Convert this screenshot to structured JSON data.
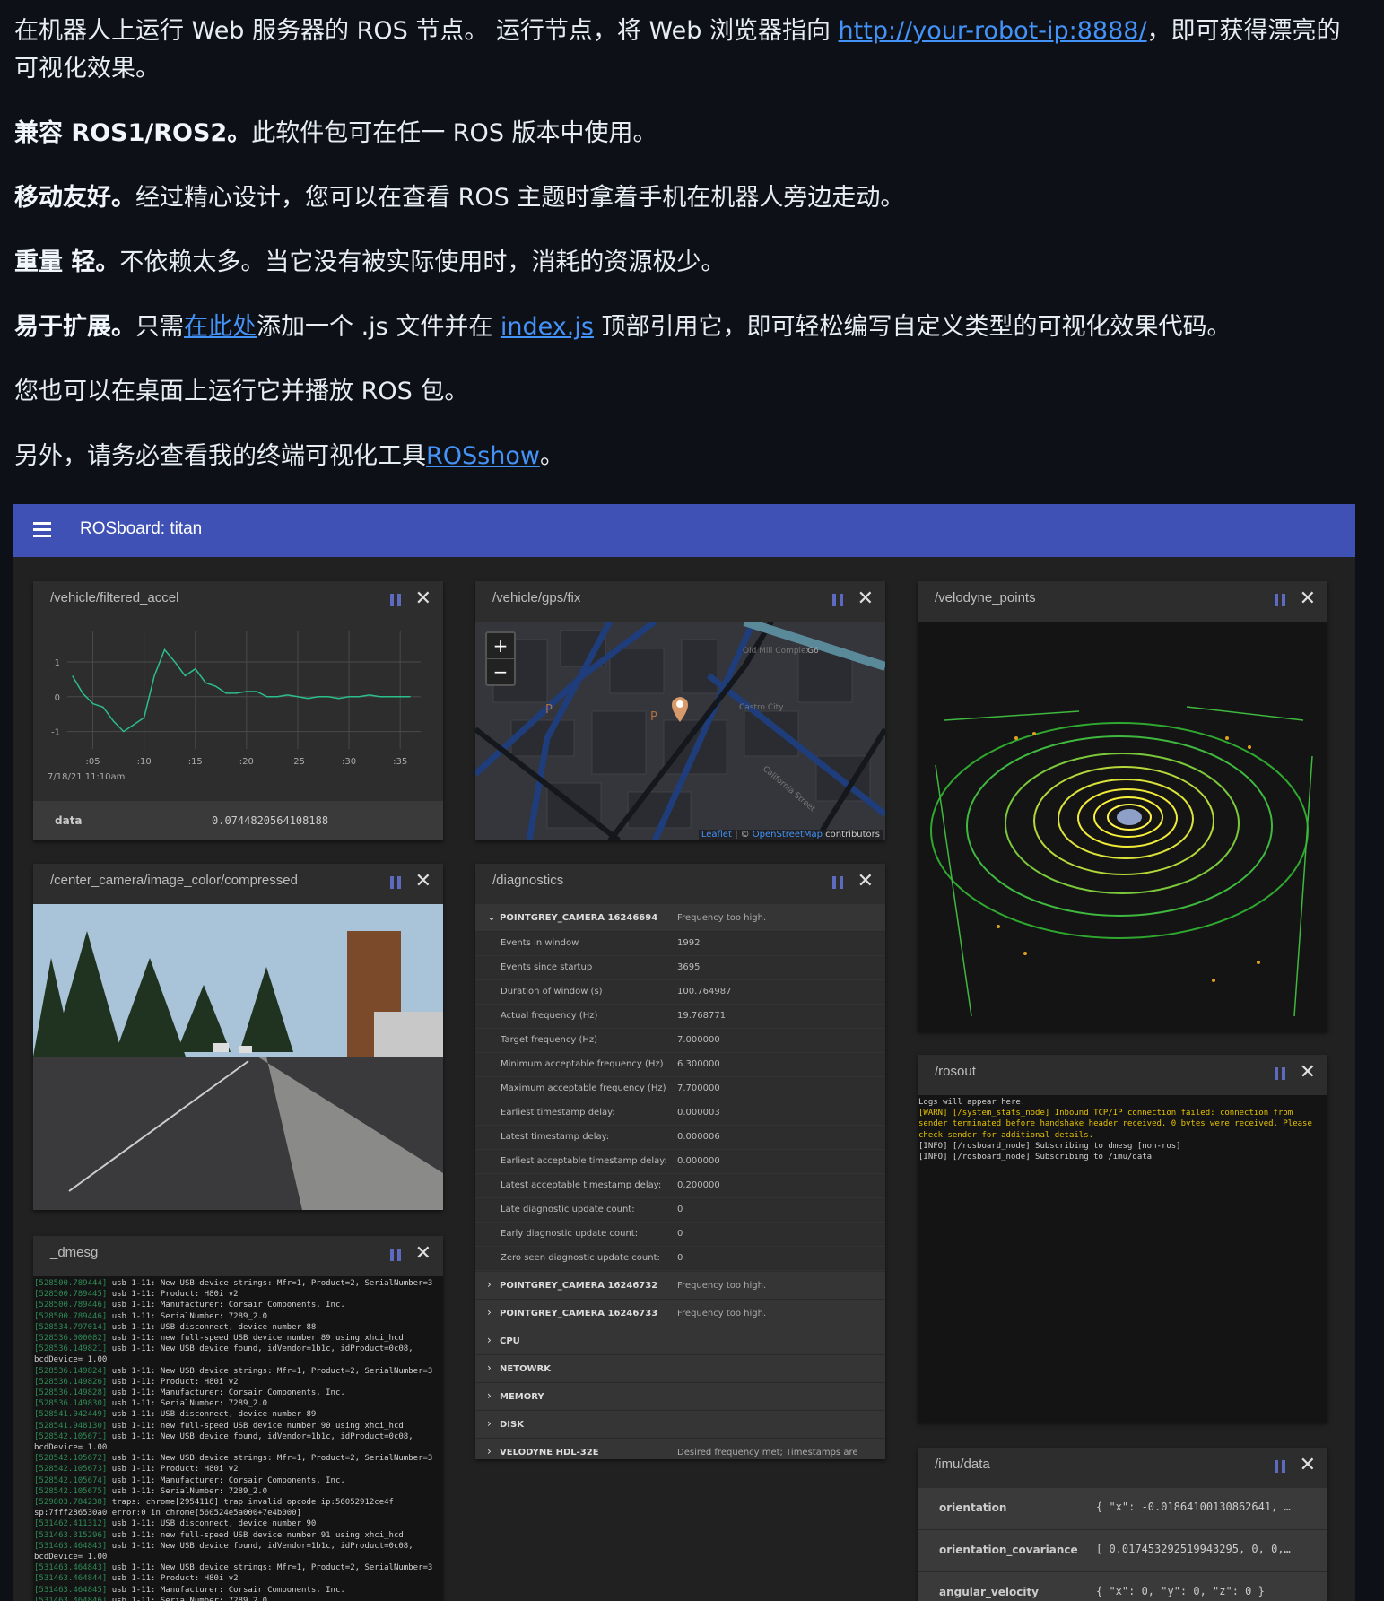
{
  "readme": {
    "p0_text_a": "在机器人上运行 Web 服务器的 ROS 节点。 运行节点，将 Web 浏览器指向 ",
    "p0_link": "http://your-robot-ip:8888/",
    "p0_text_b": "，即可获得漂亮的可视化效果。",
    "p1_bold": "兼容 ROS1/ROS2。",
    "p1_text": "此软件包可在任一 ROS 版本中使用。",
    "p2_bold": "移动友好。",
    "p2_text": "经过精心设计，您可以在查看 ROS 主题时拿着手机在机器人旁边走动。",
    "p3_bold": "重量 轻。",
    "p3_text": "不依赖太多。当它没有被实际使用时，消耗的资源极少。",
    "p4_bold": "易于扩展。",
    "p4_text_a": "只需",
    "p4_link_a": "在此处",
    "p4_text_b": "添加一个 .js 文件并在 ",
    "p4_link_b": "index.js",
    "p4_text_c": " 顶部引用它，即可轻松编写自定义类型的可视化效果代码。",
    "p5_text": "您也可以在桌面上运行它并播放 ROS 包。",
    "p6_text_a": "另外，请务必查看我的终端可视化工具",
    "p6_link": "ROSshow",
    "p6_text_b": "。"
  },
  "appbar": {
    "title": "ROSboard: titan"
  },
  "accent": "#3f51b5",
  "cards": {
    "accel": {
      "title": "/vehicle/filtered_accel",
      "data_key": "data",
      "data_value": "0.0744820564108188",
      "date_label": "7/18/21 11:10am"
    },
    "gps": {
      "title": "/vehicle/gps/fix",
      "zoom_in": "+",
      "zoom_out": "−",
      "attrib_a": "Leaflet",
      "attrib_b": " | © ",
      "attrib_c": "OpenStreetMap",
      "attrib_d": " contributors",
      "map_labels": [
        "Castro City",
        "California Street",
        "Old Mill Complex",
        "G6",
        "P",
        "P"
      ]
    },
    "velodyne": {
      "title": "/velodyne_points"
    },
    "camera": {
      "title": "/center_camera/image_color/compressed"
    },
    "diagnostics": {
      "title": "/diagnostics",
      "open_group": {
        "name": "POINTGREY_CAMERA 16246694",
        "status": "Frequency too high."
      },
      "rows": [
        {
          "k": "Events in window",
          "v": "1992"
        },
        {
          "k": "Events since startup",
          "v": "3695"
        },
        {
          "k": "Duration of window (s)",
          "v": "100.764987"
        },
        {
          "k": "Actual frequency (Hz)",
          "v": "19.768771"
        },
        {
          "k": "Target frequency (Hz)",
          "v": "7.000000"
        },
        {
          "k": "Minimum acceptable frequency (Hz)",
          "v": "6.300000"
        },
        {
          "k": "Maximum acceptable frequency (Hz)",
          "v": "7.700000"
        },
        {
          "k": "Earliest timestamp delay:",
          "v": "0.000003"
        },
        {
          "k": "Latest timestamp delay:",
          "v": "0.000006"
        },
        {
          "k": "Earliest acceptable timestamp delay:",
          "v": "0.000000"
        },
        {
          "k": "Latest acceptable timestamp delay:",
          "v": "0.200000"
        },
        {
          "k": "Late diagnostic update count:",
          "v": "0"
        },
        {
          "k": "Early diagnostic update count:",
          "v": "0"
        },
        {
          "k": "Zero seen diagnostic update count:",
          "v": "0"
        }
      ],
      "groups": [
        {
          "name": "POINTGREY_CAMERA 16246732",
          "status": "Frequency too high."
        },
        {
          "name": "POINTGREY_CAMERA 16246733",
          "status": "Frequency too high."
        },
        {
          "name": "CPU",
          "status": ""
        },
        {
          "name": "NETOWRK",
          "status": ""
        },
        {
          "name": "MEMORY",
          "status": ""
        },
        {
          "name": "DISK",
          "status": ""
        },
        {
          "name": "VELODYNE HDL-32E",
          "status": "Desired frequency met; Timestamps are reas..."
        }
      ]
    },
    "rosout": {
      "title": "/rosout",
      "lines": [
        {
          "cls": "",
          "text": "Logs will appear here."
        },
        {
          "cls": "warn",
          "text": "[WARN] [/system_stats_node] Inbound TCP/IP connection failed: connection from"
        },
        {
          "cls": "warn",
          "text": "sender terminated before handshake header received. 0 bytes were received. Please"
        },
        {
          "cls": "warn",
          "text": "check sender for additional details."
        },
        {
          "cls": "",
          "text": "[INFO] [/rosboard_node] Subscribing to dmesg [non-ros]"
        },
        {
          "cls": "",
          "text": "[INFO] [/rosboard_node] Subscribing to /imu/data"
        }
      ]
    },
    "dmesg": {
      "title": "_dmesg",
      "lines": [
        {
          "ts": "[528500.789444]",
          "text": " usb 1-11: New USB device strings: Mfr=1, Product=2, SerialNumber=3"
        },
        {
          "ts": "[528500.789445]",
          "text": " usb 1-11: Product: H80i v2"
        },
        {
          "ts": "[528500.789446]",
          "text": " usb 1-11: Manufacturer: Corsair Components, Inc."
        },
        {
          "ts": "[528500.789446]",
          "text": " usb 1-11: SerialNumber: 7289_2.0"
        },
        {
          "ts": "[528534.797014]",
          "text": " usb 1-11: USB disconnect, device number 88"
        },
        {
          "ts": "[528536.000082]",
          "text": " usb 1-11: new full-speed USB device number 89 using xhci_hcd"
        },
        {
          "ts": "[528536.149821]",
          "text": " usb 1-11: New USB device found, idVendor=1b1c, idProduct=0c08,"
        },
        {
          "ts": "",
          "text": "bcdDevice= 1.00"
        },
        {
          "ts": "[528536.149824]",
          "text": " usb 1-11: New USB device strings: Mfr=1, Product=2, SerialNumber=3"
        },
        {
          "ts": "[528536.149826]",
          "text": " usb 1-11: Product: H80i v2"
        },
        {
          "ts": "[528536.149828]",
          "text": " usb 1-11: Manufacturer: Corsair Components, Inc."
        },
        {
          "ts": "[528536.149830]",
          "text": " usb 1-11: SerialNumber: 7289_2.0"
        },
        {
          "ts": "[528541.042449]",
          "text": " usb 1-11: USB disconnect, device number 89"
        },
        {
          "ts": "[528541.948130]",
          "text": " usb 1-11: new full-speed USB device number 90 using xhci_hcd"
        },
        {
          "ts": "[528542.105671]",
          "text": " usb 1-11: New USB device found, idVendor=1b1c, idProduct=0c08,"
        },
        {
          "ts": "",
          "text": "bcdDevice= 1.00"
        },
        {
          "ts": "[528542.105672]",
          "text": " usb 1-11: New USB device strings: Mfr=1, Product=2, SerialNumber=3"
        },
        {
          "ts": "[528542.105673]",
          "text": " usb 1-11: Product: H80i v2"
        },
        {
          "ts": "[528542.105674]",
          "text": " usb 1-11: Manufacturer: Corsair Components, Inc."
        },
        {
          "ts": "[528542.105675]",
          "text": " usb 1-11: SerialNumber: 7289_2.0"
        },
        {
          "ts": "[529803.784238]",
          "text": " traps: chrome[2954116] trap invalid opcode ip:56052912ce4f"
        },
        {
          "ts": "",
          "text": "sp:7fff286530a0 error:0 in chrome[560524e5a000+7e4b000]"
        },
        {
          "ts": "[531462.411312]",
          "text": " usb 1-11: USB disconnect, device number 90"
        },
        {
          "ts": "[531463.315296]",
          "text": " usb 1-11: new full-speed USB device number 91 using xhci_hcd"
        },
        {
          "ts": "[531463.464843]",
          "text": " usb 1-11: New USB device found, idVendor=1b1c, idProduct=0c08,"
        },
        {
          "ts": "",
          "text": "bcdDevice= 1.00"
        },
        {
          "ts": "[531463.464843]",
          "text": " usb 1-11: New USB device strings: Mfr=1, Product=2, SerialNumber=3"
        },
        {
          "ts": "[531463.464844]",
          "text": " usb 1-11: Product: H80i v2"
        },
        {
          "ts": "[531463.464845]",
          "text": " usb 1-11: Manufacturer: Corsair Components, Inc."
        },
        {
          "ts": "[531463.464846]",
          "text": " usb 1-11: SerialNumber: 7289_2.0"
        }
      ]
    },
    "imu": {
      "title": "/imu/data",
      "rows": [
        {
          "k": "orientation",
          "v": "{ \"x\": -0.01864100130862641, …"
        },
        {
          "k": "orientation_covariance",
          "v": "[ 0.017453292519943295, 0, 0,…"
        },
        {
          "k": "angular_velocity",
          "v": "{ \"x\": 0, \"y\": 0, \"z\": 0 }"
        }
      ]
    }
  },
  "chart_data": {
    "type": "line",
    "x": [
      3,
      4,
      5,
      6,
      7,
      8,
      9,
      10,
      11,
      12,
      13,
      14,
      15,
      16,
      17,
      18,
      19,
      20,
      21,
      22,
      23,
      24,
      25,
      26,
      27,
      28,
      29,
      30,
      31,
      32,
      33,
      34,
      35,
      36
    ],
    "series": [
      {
        "values": [
          0.6,
          0.1,
          -0.2,
          -0.3,
          -0.7,
          -1.0,
          -0.8,
          -0.6,
          0.6,
          1.35,
          1.0,
          0.6,
          0.8,
          0.4,
          0.3,
          0.1,
          0.1,
          0.15,
          0.15,
          0.0,
          0.0,
          0.05,
          0.0,
          -0.05,
          0.0,
          0.0,
          -0.05,
          0.0,
          0.0,
          0.05,
          0.0,
          0.0,
          0.0,
          0.0
        ],
        "color": "#2bbf8a"
      }
    ],
    "x_ticks": [
      ":05",
      ":10",
      ":15",
      ":20",
      ":25",
      ":30",
      ":35"
    ],
    "x_tick_values": [
      5,
      10,
      15,
      20,
      25,
      30,
      35
    ],
    "y_ticks": [
      "1",
      "0",
      "-1"
    ],
    "y_tick_values": [
      1,
      0,
      -1
    ],
    "xlim": [
      2.5,
      37
    ],
    "ylim": [
      -1.5,
      1.9
    ],
    "title": "",
    "xlabel": "7/18/21 11:10am",
    "ylabel": "",
    "grid": true
  }
}
